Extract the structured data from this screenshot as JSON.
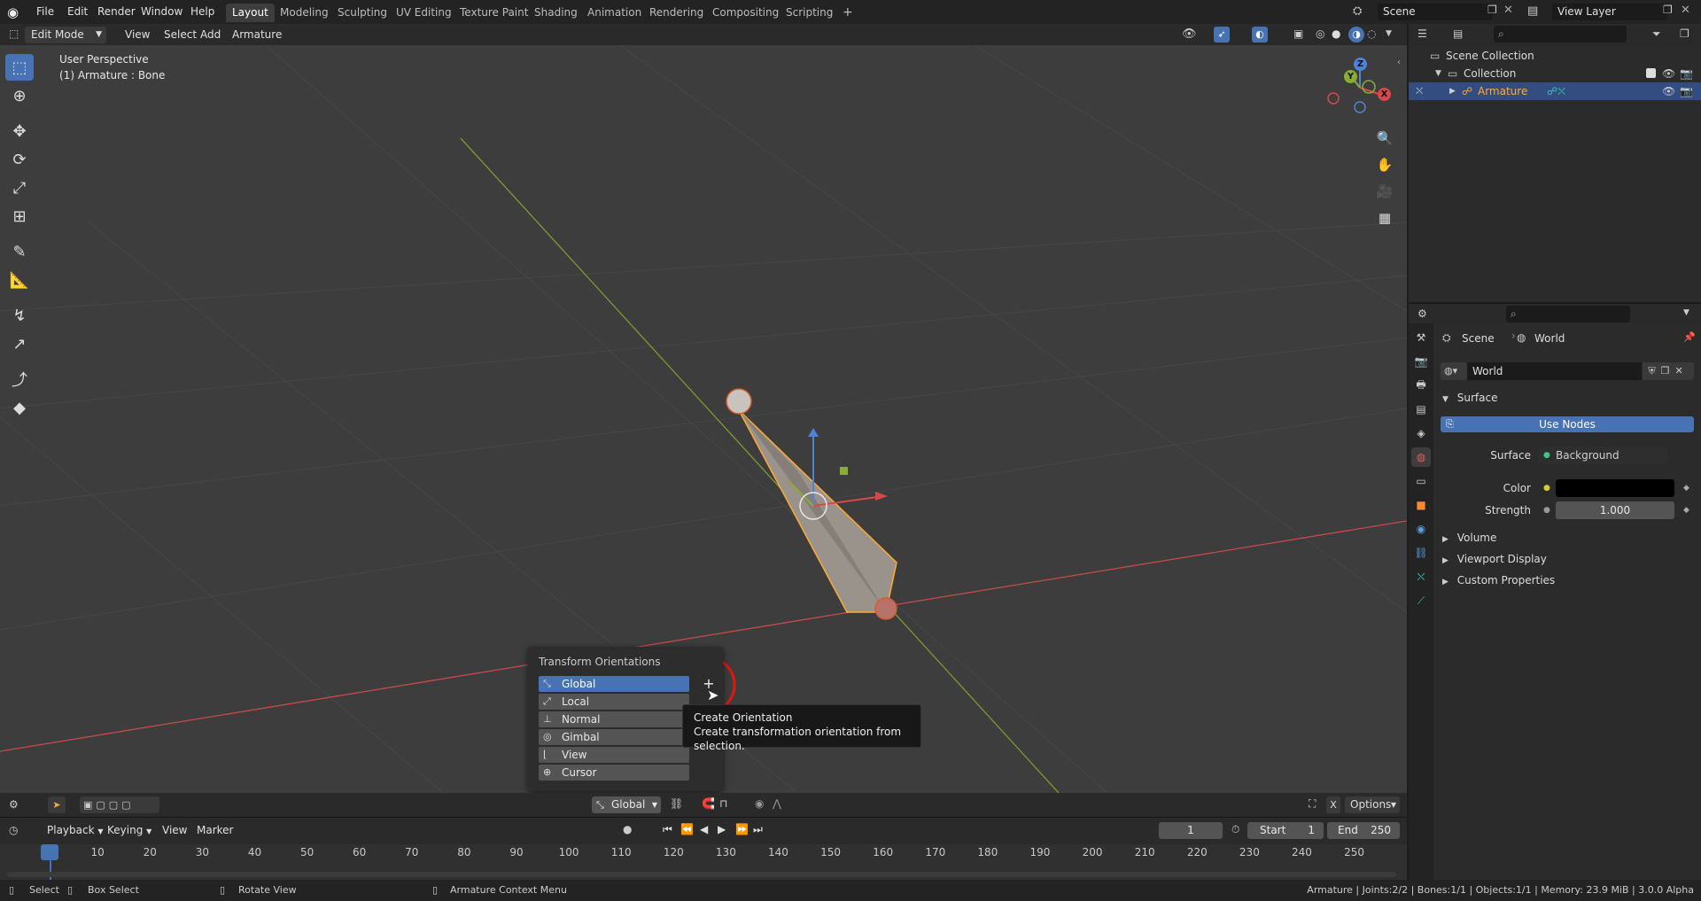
{
  "menu": {
    "file": "File",
    "edit": "Edit",
    "render": "Render",
    "window": "Window",
    "help": "Help"
  },
  "workspaces": [
    "Layout",
    "Modeling",
    "Sculpting",
    "UV Editing",
    "Texture Paint",
    "Shading",
    "Animation",
    "Rendering",
    "Compositing",
    "Scripting"
  ],
  "add_tab": "+",
  "scene_field": "Scene",
  "view_layer_field": "View Layer",
  "viewport_header": {
    "mode": "Edit Mode",
    "view": "View",
    "select": "Select",
    "add": "Add",
    "armature": "Armature"
  },
  "viewport": {
    "perspective": "User Perspective",
    "object_info": "(1) Armature : Bone"
  },
  "gizmo": {
    "z": "Z",
    "y": "Y",
    "x": "X"
  },
  "popup": {
    "title": "Transform Orientations",
    "options": [
      "Global",
      "Local",
      "Normal",
      "Gimbal",
      "View",
      "Cursor"
    ],
    "selected": "Global",
    "add_button": "+"
  },
  "tooltip": {
    "title": "Create Orientation",
    "description": "Create transformation orientation from selection."
  },
  "vp_footer": {
    "orientation": "Global",
    "options": "Options",
    "x_label": "X"
  },
  "timeline_header": {
    "playback": "Playback",
    "keying": "Keying",
    "view": "View",
    "marker": "Marker",
    "current_frame": "1",
    "start_label": "Start",
    "start": "1",
    "end_label": "End",
    "end": "250"
  },
  "timeline_ticks": [
    "1",
    "10",
    "20",
    "30",
    "40",
    "50",
    "60",
    "70",
    "80",
    "90",
    "100",
    "110",
    "120",
    "130",
    "140",
    "150",
    "160",
    "170",
    "180",
    "190",
    "200",
    "210",
    "220",
    "230",
    "240",
    "250"
  ],
  "status": {
    "select": "Select",
    "box_select": "Box Select",
    "rotate_view": "Rotate View",
    "context_menu": "Armature Context Menu",
    "stats": "Armature | Joints:2/2 | Bones:1/1 | Objects:1/1 | Memory: 23.9 MiB | 3.0.0 Alpha"
  },
  "outliner": {
    "scene_collection": "Scene Collection",
    "collection": "Collection",
    "armature": "Armature"
  },
  "properties": {
    "breadcrumb_scene": "Scene",
    "breadcrumb_world": "World",
    "world_name": "World",
    "surface_panel": "Surface",
    "use_nodes": "Use Nodes",
    "surface_label": "Surface",
    "surface_value": "Background",
    "color_label": "Color",
    "strength_label": "Strength",
    "strength_value": "1.000",
    "panels": [
      "Volume",
      "Viewport Display",
      "Custom Properties"
    ]
  },
  "colors": {
    "accent": "#4772b3",
    "bone_outline": "#ffaa33",
    "x_axis": "#d94848",
    "y_axis": "#8aad34",
    "z_axis": "#4f83d8",
    "tooltip_bg": "#181818",
    "click_marker": "#e01515"
  }
}
